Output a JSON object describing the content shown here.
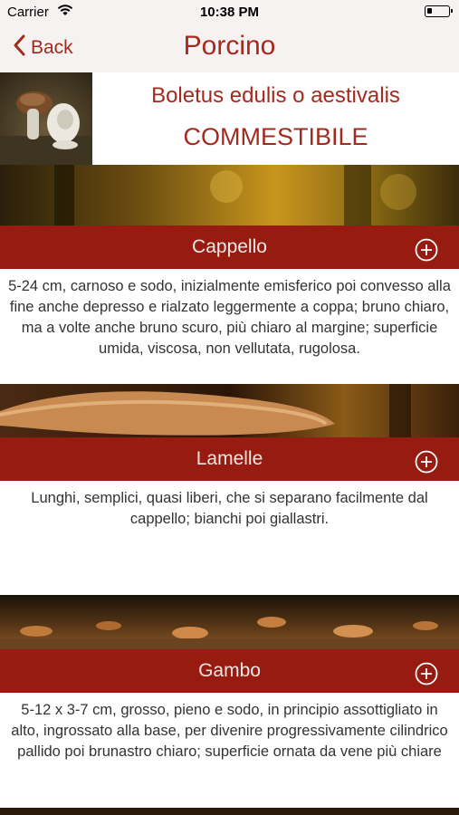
{
  "status_bar": {
    "carrier": "Carrier",
    "time": "10:38 PM",
    "battery_level": 0.25
  },
  "nav": {
    "back_label": "Back",
    "title": "Porcino"
  },
  "header": {
    "scientific_name": "Boletus edulis o aestivalis",
    "edibility": "COMMESTIBILE"
  },
  "sections": [
    {
      "title": "Cappello",
      "text": "5-24 cm, carnoso e sodo, inizialmente emisferico poi convesso alla fine anche depresso e rialzato leggermente a coppa; bruno chiaro, ma a volte anche bruno scuro, più chiaro al margine; superficie umida, viscosa, non vellutata, rugolosa."
    },
    {
      "title": "Lamelle",
      "text": "Lunghi, semplici, quasi liberi, che si separano facilmente dal cappello; bianchi poi giallastri."
    },
    {
      "title": "Gambo",
      "text": "5-12 x 3-7 cm, grosso, pieno e sodo, in principio assottigliato in alto, ingrossato alla base, per divenire progressivamente cilindrico pallido poi brunastro chiaro; superficie ornata da vene più chiare"
    }
  ],
  "colors": {
    "accent": "#a32a1e",
    "section_bar": "#971b10",
    "nav_background": "#f6f2f1"
  },
  "icons": [
    "wifi-icon",
    "battery-icon",
    "chevron-left-icon",
    "plus-circle-icon"
  ]
}
